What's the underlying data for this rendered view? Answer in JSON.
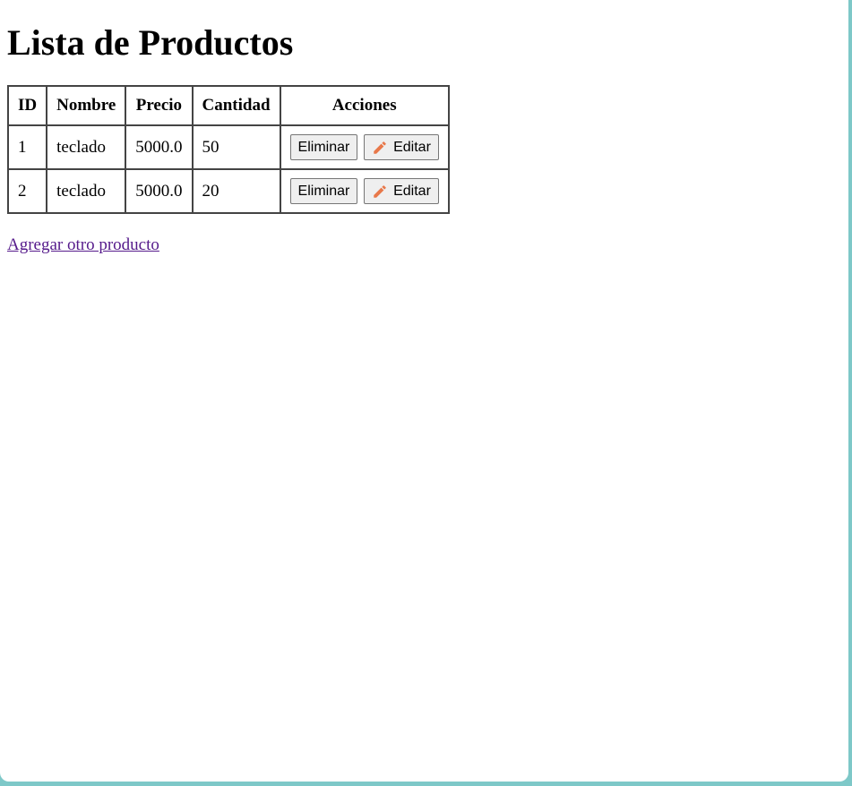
{
  "page": {
    "title": "Lista de Productos",
    "add_link": "Agregar otro producto"
  },
  "table": {
    "headers": [
      "ID",
      "Nombre",
      "Precio",
      "Cantidad",
      "Acciones"
    ],
    "rows": [
      {
        "id": "1",
        "nombre": "teclado",
        "precio": "5000.0",
        "cantidad": "50"
      },
      {
        "id": "2",
        "nombre": "teclado",
        "precio": "5000.0",
        "cantidad": "20"
      }
    ],
    "delete_label": "Eliminar",
    "edit_label": "Editar",
    "edit_icon": "pencil-icon"
  },
  "colors": {
    "pencil": "#e8784a",
    "link_visited": "#551a8b",
    "frame": "#7ec8c8"
  }
}
